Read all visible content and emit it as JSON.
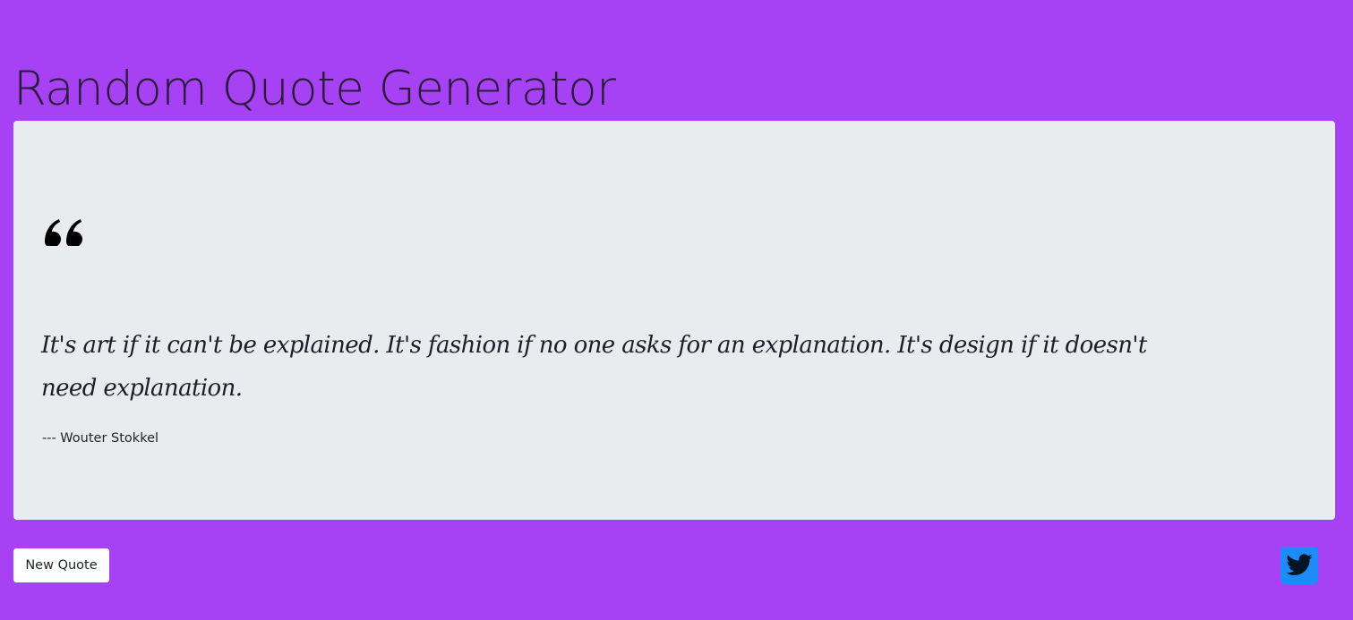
{
  "header": {
    "title": "Random Quote Generator"
  },
  "quote": {
    "icon": "quote-left-icon",
    "text": "It's art if it can't be explained. It's fashion if no one asks for an explanation. It's design if it doesn't need explanation.",
    "author": "--- Wouter Stokkel"
  },
  "actions": {
    "new_quote_label": "New Quote",
    "tweet_icon": "twitter-icon"
  },
  "colors": {
    "background": "#a641f4",
    "card": "#e9ecef",
    "twitter": "#1d8cf8"
  }
}
